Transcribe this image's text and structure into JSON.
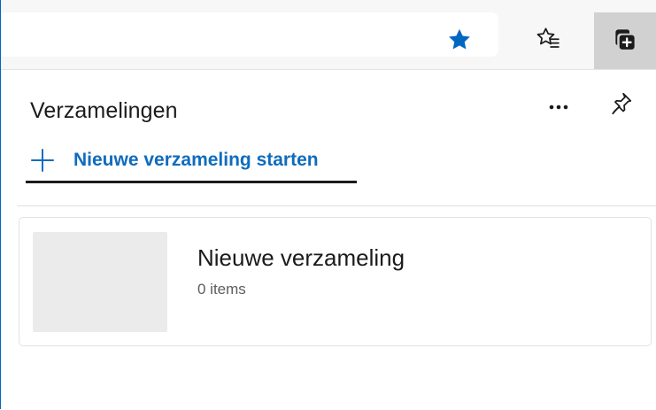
{
  "toolbar": {
    "icons": {
      "favorite_star": "star-filled-icon",
      "favorites": "favorites-list-icon",
      "collections": "collections-icon"
    },
    "accent": "#0f6cbd"
  },
  "panel": {
    "title": "Verzamelingen",
    "new_collection_label": "Nieuwe verzameling starten",
    "icons": {
      "more": "more-options-icon",
      "pin": "pin-icon",
      "add": "plus-icon"
    }
  },
  "collections": [
    {
      "name": "Nieuwe verzameling",
      "count": "0 items"
    }
  ]
}
